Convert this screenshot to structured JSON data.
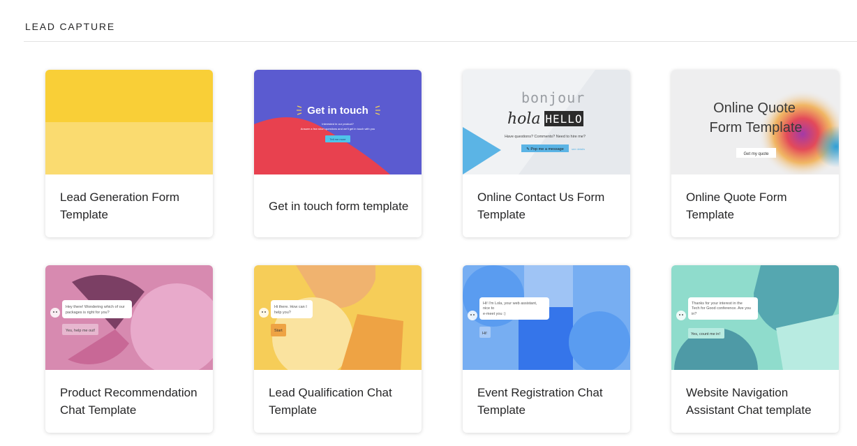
{
  "section": {
    "title": "LEAD CAPTURE"
  },
  "templates": [
    {
      "title": "Lead Generation Form Template",
      "thumb_colors": [
        "#f9cf37",
        "#fadb70"
      ]
    },
    {
      "title": "Get in touch form template",
      "thumb": {
        "heading": "Get in touch",
        "line1": "Interested in our product?",
        "line2": "Answer a few short questions and we'll get in touch with you",
        "button": "Tell me more"
      },
      "thumb_colors": [
        "#5b5bd0",
        "#e8414f",
        "#4fc4ea"
      ]
    },
    {
      "title": "Online Contact Us Form Template",
      "thumb": {
        "word1": "bonjour",
        "word2": "hola",
        "word3": "HELLO",
        "line": "Have questions? Comments? Need to hire me?",
        "button": "✎ Pop me a message",
        "link": "see details"
      },
      "thumb_colors": [
        "#f0f2f4",
        "#5bb4e5",
        "#2b2b2b"
      ]
    },
    {
      "title": "Online Quote Form Template",
      "thumb": {
        "line1": "Online Quote",
        "line2": "Form Template",
        "button": "Get my quote"
      },
      "thumb_colors": [
        "#eeeeef",
        "#e94f4f",
        "#9c3fa8",
        "#f0a430",
        "#3fa7d6"
      ]
    },
    {
      "title": "Product Recommendation Chat Template",
      "thumb": {
        "bubble": "Hey there! Wondering which of our packages is right for you?",
        "reply": "Yes, help me out!"
      },
      "thumb_colors": [
        "#d78ab0",
        "#7b3f64",
        "#e8aacb",
        "#c86896"
      ]
    },
    {
      "title": "Lead Qualification Chat Template",
      "thumb": {
        "bubble": "Hi there. How can I help you?",
        "reply": "Start"
      },
      "thumb_colors": [
        "#f6cd58",
        "#f0b36f",
        "#fae39f",
        "#eea344"
      ]
    },
    {
      "title": "Event Registration Chat Template",
      "thumb": {
        "bubble": "Hi! I'm Lola, your web assistant, nice to e-meet you :)",
        "reply": "Hi!"
      },
      "thumb_colors": [
        "#77aef2",
        "#5a9cf0",
        "#9fc4f5",
        "#3575ea"
      ]
    },
    {
      "title": "Website Navigation Assistant Chat template",
      "thumb": {
        "bubble": "Thanks for your interest in the Tech for Good conference. Are you in?",
        "reply": "Yes, count me in!"
      },
      "thumb_colors": [
        "#8fdccc",
        "#55a7b0",
        "#b8ebe1",
        "#4e9aa6"
      ]
    }
  ]
}
